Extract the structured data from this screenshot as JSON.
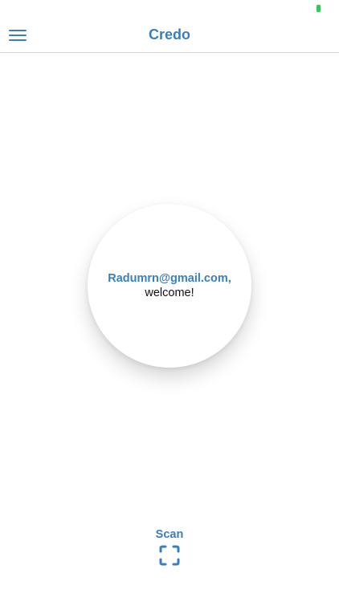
{
  "status_bar": {
    "battery_color": "#34c759"
  },
  "header": {
    "title": "Credo",
    "menu_icon": "hamburger-menu-icon"
  },
  "welcome": {
    "email": "Radumrn@gmail.com,",
    "message": "welcome!"
  },
  "scan": {
    "label": "Scan",
    "icon": "scan-frame-icon"
  },
  "colors": {
    "accent": "#3a7fbd",
    "text": "#111111",
    "background": "#ffffff"
  }
}
